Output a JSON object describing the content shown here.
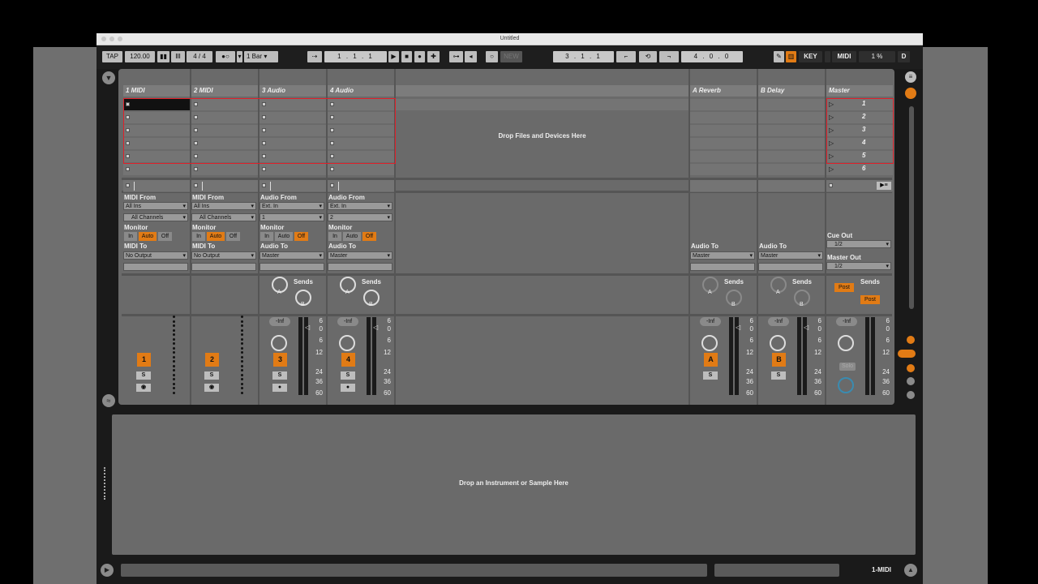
{
  "window": {
    "title": "Untitled"
  },
  "toolbar": {
    "tap": "TAP",
    "tempo": "120.00",
    "signature": "4 / 4",
    "quantize": "1 Bar",
    "position": "1 . 1 . 1",
    "new": "NEW",
    "loop_start": "3 . 1 . 1",
    "loop_length": "4 . 0 . 0",
    "key": "KEY",
    "midi": "MIDI",
    "cpu": "1 %",
    "disk": "D"
  },
  "tracks": [
    {
      "name": "1 MIDI",
      "num": "1"
    },
    {
      "name": "2 MIDI",
      "num": "2"
    },
    {
      "name": "3 Audio",
      "num": "3"
    },
    {
      "name": "4 Audio",
      "num": "4"
    }
  ],
  "returns": [
    {
      "name": "A Reverb",
      "btn": "A"
    },
    {
      "name": "B Delay",
      "btn": "B"
    }
  ],
  "master": {
    "name": "Master",
    "scenes": [
      "1",
      "2",
      "3",
      "4",
      "5",
      "6"
    ],
    "cue_out_label": "Cue Out",
    "cue_out": "1/2",
    "master_out_label": "Master Out",
    "master_out": "1/2",
    "post": "Post",
    "solo": "Solo"
  },
  "io": {
    "midi_from": "MIDI From",
    "all_ins": "All Ins",
    "all_channels": "All Channels",
    "monitor": "Monitor",
    "in": "In",
    "auto": "Auto",
    "off": "Off",
    "midi_to": "MIDI To",
    "no_output": "No Output",
    "audio_from": "Audio From",
    "ext_in": "Ext. In",
    "ch1": "1",
    "ch2": "2",
    "audio_to": "Audio To",
    "master": "Master",
    "sends": "Sends",
    "a": "A",
    "b": "B",
    "s": "S",
    "inf": "-Inf"
  },
  "meter_scale": [
    "6",
    "0",
    "6",
    "12",
    "24",
    "36",
    "60"
  ],
  "drop_files": "Drop Files and Devices Here",
  "drop_instrument": "Drop an Instrument or Sample Here",
  "status": {
    "selected_track": "1-MIDI"
  }
}
